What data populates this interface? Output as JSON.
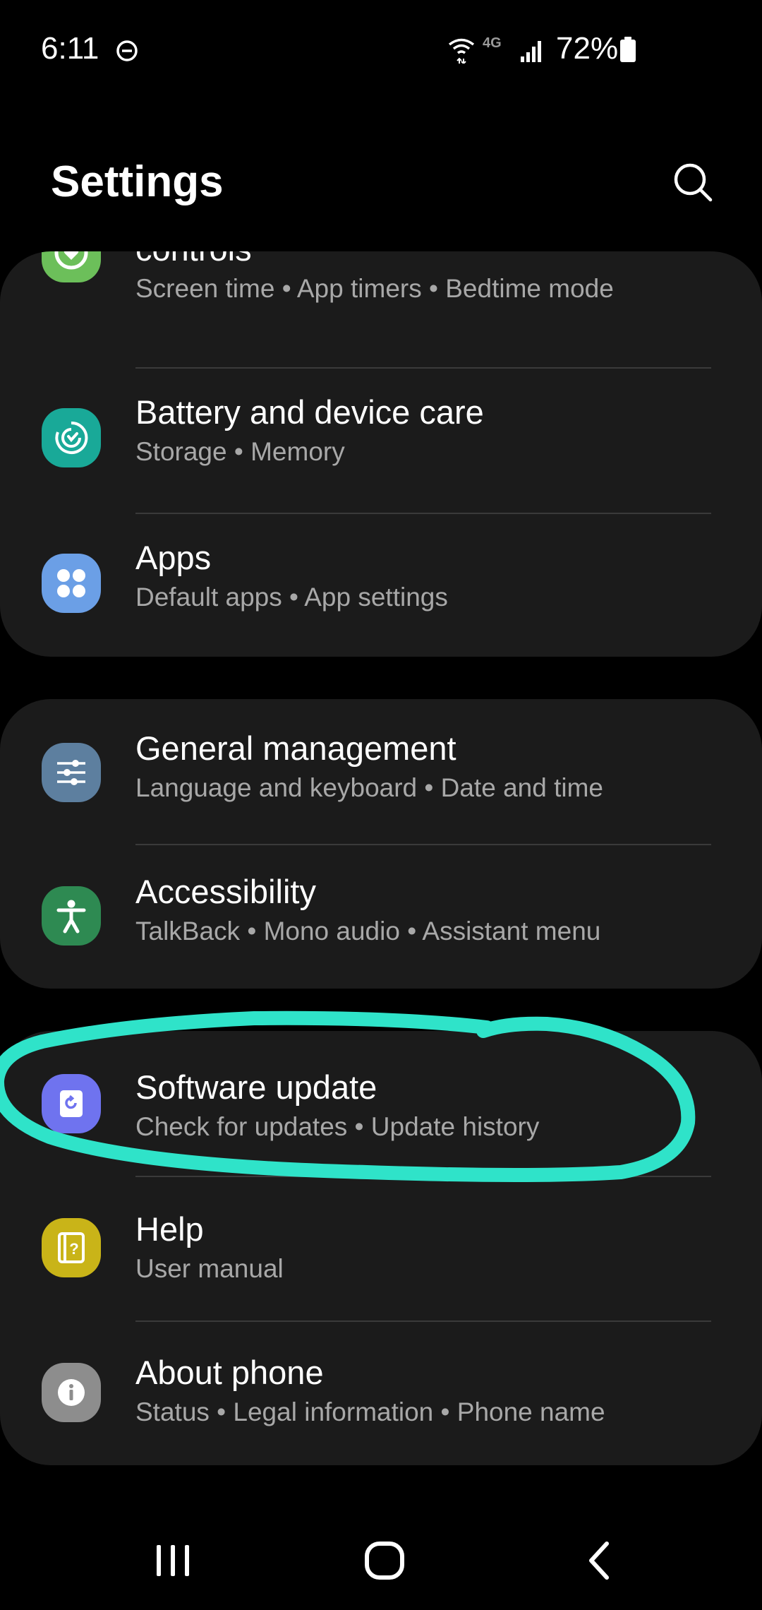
{
  "status_bar": {
    "time": "6:11",
    "battery_percent": "72%",
    "network": "4G"
  },
  "header": {
    "title": "Settings"
  },
  "sections": [
    {
      "items": [
        {
          "title": "controls",
          "subtitle": "Screen time  •  App timers  •  Bedtime mode",
          "icon": "digital-wellbeing-icon",
          "color": "#6cbf5a"
        },
        {
          "title": "Battery and device care",
          "subtitle": "Storage  •  Memory",
          "icon": "device-care-icon",
          "color": "#19a998"
        },
        {
          "title": "Apps",
          "subtitle": "Default apps  •  App settings",
          "icon": "apps-icon",
          "color": "#6b9fe6"
        }
      ]
    },
    {
      "items": [
        {
          "title": "General management",
          "subtitle": "Language and keyboard  •  Date and time",
          "icon": "sliders-icon",
          "color": "#5d7f9f"
        },
        {
          "title": "Accessibility",
          "subtitle": "TalkBack  •  Mono audio  •  Assistant menu",
          "icon": "accessibility-icon",
          "color": "#2e8a52"
        }
      ]
    },
    {
      "items": [
        {
          "title": "Software update",
          "subtitle": "Check for updates  •  Update history",
          "icon": "software-update-icon",
          "color": "#6f73ef"
        },
        {
          "title": "Help",
          "subtitle": "User manual",
          "icon": "help-icon",
          "color": "#c9b418"
        },
        {
          "title": "About phone",
          "subtitle": "Status  •  Legal information  •  Phone name",
          "icon": "info-icon",
          "color": "#8d8d8d"
        }
      ]
    }
  ],
  "annotation_color": "#2fe3c9"
}
